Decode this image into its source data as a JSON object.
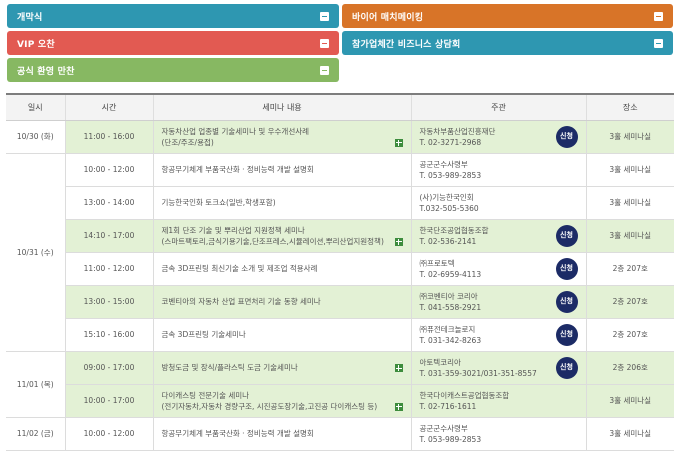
{
  "accordions": [
    {
      "label": "개막식"
    },
    {
      "label": "바이어 매치메이킹"
    },
    {
      "label": "VIP 오찬"
    },
    {
      "label": "참가업체간 비즈니스 상담회"
    },
    {
      "label": "공식 환영 만찬"
    }
  ],
  "table": {
    "headers": [
      "일시",
      "시간",
      "세미나 내용",
      "주관",
      "장소"
    ],
    "apply_label": "신청",
    "days": [
      "10/30 (화)",
      "10/31 (수)",
      "11/01 (목)",
      "11/02 (금)"
    ],
    "rows": [
      {
        "time": "11:00 - 16:00",
        "seminar": [
          "자동차산업 업종별 기술세미나 및 우수개선사례",
          "(단조/주조/용접)"
        ],
        "host": "자동차부품산업진흥재단",
        "tel": "T. 02-3271-2968",
        "room": "3홀 세미나실"
      },
      {
        "time": "10:00 - 12:00",
        "seminar": [
          "항공무기체계 부품국산화 · 정비능력 개발 설명회"
        ],
        "host": "공군군수사령부",
        "tel": "T. 053-989-2853",
        "room": "3홀 세미나실"
      },
      {
        "time": "13:00 - 14:00",
        "seminar": [
          "기능한국인화 토크쇼(일반,학생포함)"
        ],
        "host": "(사)기능한국인회",
        "tel": "T.032-505-5360",
        "room": "3홀 세미나실"
      },
      {
        "time": "14:10 - 17:00",
        "seminar": [
          "제1회 단조 기술 및 뿌리산업 지원정책 세미나",
          "(스마트팩토리,금식기용기술,단조프레스,시뮬레이션,뿌리산업지원정책)"
        ],
        "host": "한국단조공업협동조합",
        "tel": "T. 02-536-2141",
        "room": "3홀 세미나실"
      },
      {
        "time": "11:00 - 12:00",
        "seminar": [
          "금속 3D프린팅 최신기술 소개 및 제조업 적용사례"
        ],
        "host": "㈜프로토텍",
        "tel": "T. 02-6959-4113",
        "room": "2층 207호"
      },
      {
        "time": "13:00 - 15:00",
        "seminar": [
          "코벤티아의 자동차 산업 표면처리 기술 동향 세미나"
        ],
        "host": "㈜코벤티아 코리아",
        "tel": "T. 041-558-2921",
        "room": "2층 207호"
      },
      {
        "time": "15:10 - 16:00",
        "seminar": [
          "금속 3D프린팅 기술세미나"
        ],
        "host": "㈜퓨전테크놀로지",
        "tel": "T. 031-342-8263",
        "room": "2층 207호"
      },
      {
        "time": "09:00 - 17:00",
        "seminar": [
          "방청도금 및 장식/플라스틱 도금 기술세미나"
        ],
        "host": "아토텍코리아",
        "tel": "T. 031-359-3021/031-351-8557",
        "room": "2층 206호"
      },
      {
        "time": "10:00 - 17:00",
        "seminar": [
          "다이캐스팅 전문기술 세미나",
          "(전기자동차,자동차 경량구조, 시진공도장기술,고진공 다이캐스팅 등)"
        ],
        "host": "한국다이캐스트공업협동조합",
        "tel": "T. 02-716-1611",
        "room": "3홀 세미나실"
      },
      {
        "time": "10:00 - 12:00",
        "seminar": [
          "항공무기체계 부품국산화 · 정비능력 개발 설명회"
        ],
        "host": "공군군수사령부",
        "tel": "T. 053-989-2853",
        "room": "3홀 세미나실"
      }
    ]
  }
}
